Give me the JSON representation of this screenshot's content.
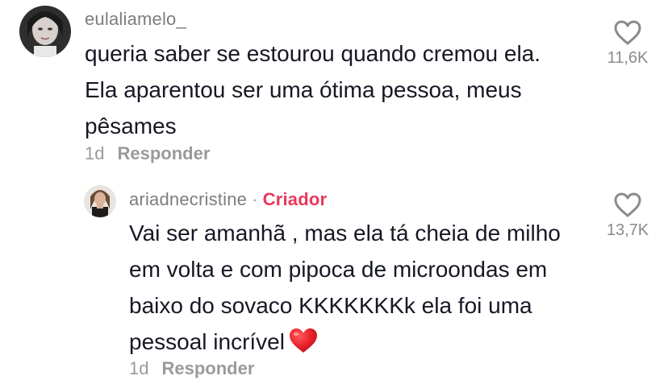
{
  "comments": [
    {
      "username": "eulaliamelo_",
      "lines": [
        "queria saber se estourou quando cremou ela.",
        "Ela aparentou ser uma ótima pessoa, meus",
        "pêsames"
      ],
      "time": "1d",
      "reply_label": "Responder",
      "like_count": "11,6K",
      "like_icon": "heart-outline-icon"
    },
    {
      "username": "ariadnecristine",
      "separator": "·",
      "badge": "Criador",
      "lines": [
        "Vai ser amanhã , mas ela tá cheia de milho",
        "em volta e com pipoca de microondas em",
        "baixo do sovaco KKKKKKKk ela foi uma",
        "pessoal incrível"
      ],
      "emoji": "red-heart-emoji",
      "time": "1d",
      "reply_label": "Responder",
      "like_count": "13,7K",
      "like_icon": "heart-outline-icon"
    }
  ],
  "colors": {
    "creator_badge": "#e8385b",
    "body_text": "#161823",
    "muted_text": "#9a9a9a"
  }
}
